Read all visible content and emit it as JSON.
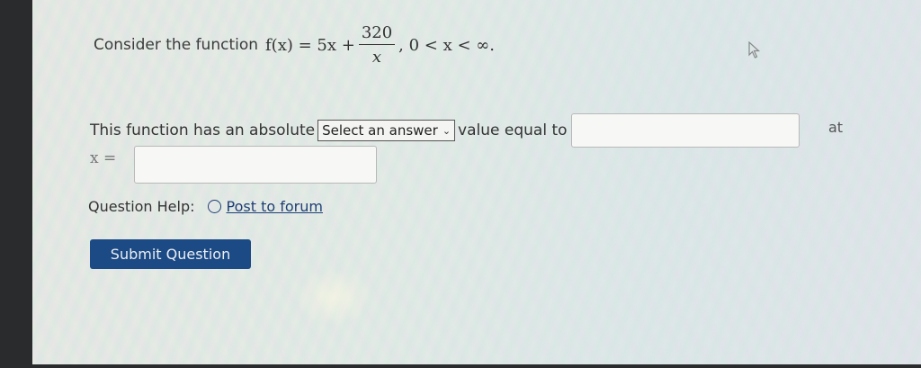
{
  "question": {
    "prefix": "Consider the function",
    "func": "f(x) = 5x +",
    "numerator": "320",
    "denominator": "x",
    "domain": ", 0 < x < ∞."
  },
  "answer_row": {
    "text_before": "This function has an absolute",
    "select_value": "Select an answer",
    "text_middle": "value equal to",
    "value_input": "",
    "text_after": "at"
  },
  "x_row": {
    "label": "x =",
    "input": ""
  },
  "help": {
    "label": "Question Help:",
    "forum_link": "Post to forum"
  },
  "submit": {
    "label": "Submit Question"
  },
  "icons": {
    "forum": "forum-icon",
    "select_chevron": "chevron-down-icon",
    "cursor": "mouse-pointer-icon"
  },
  "colors": {
    "submit_bg": "#1c4a84",
    "link": "#1f3f75"
  }
}
